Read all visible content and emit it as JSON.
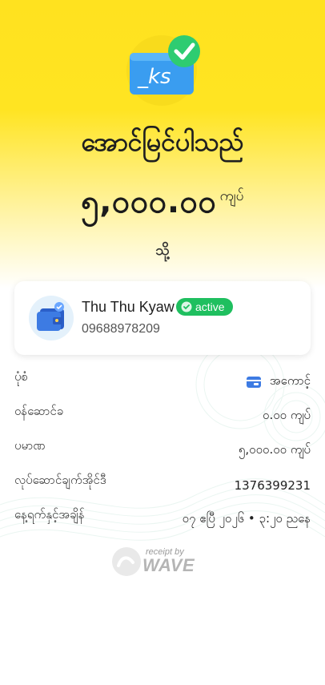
{
  "status": {
    "title": "အောင်မြင်ပါသည်",
    "amount": "၅,၀၀၀.၀၀",
    "currency": "ကျပ်",
    "to_label": "သို့",
    "icon": "wallet-ks-check-icon"
  },
  "recipient": {
    "name": "Thu Thu Kyaw",
    "badge": "active",
    "phone": "09688978209",
    "avatar_icon": "wallet-avatar-icon"
  },
  "details": [
    {
      "label": "ပုံစံ",
      "value": "အကောင့်",
      "icon": "account-icon"
    },
    {
      "label": "ဝန်ဆောင်ခ",
      "value": "၀.၀၀ ကျပ်"
    },
    {
      "label": "ပမာဏ",
      "value": "၅,၀၀၀.၀၀ ကျပ်"
    },
    {
      "label": "လုပ်ဆောင်ချက်အိုင်ဒီ",
      "value": "1376399231"
    },
    {
      "label": "နေ့ရက်နှင့်အချိန်",
      "value": "၀၇ ဧပြီ ၂၀၂၆ • ၃:၂၀ ညနေ"
    }
  ],
  "footer": {
    "small": "receipt by",
    "brand": "WAVE"
  },
  "colors": {
    "brand_yellow": "#ffe21f",
    "active_green": "#1fbf5f",
    "wallet_blue": "#2f7be6"
  }
}
